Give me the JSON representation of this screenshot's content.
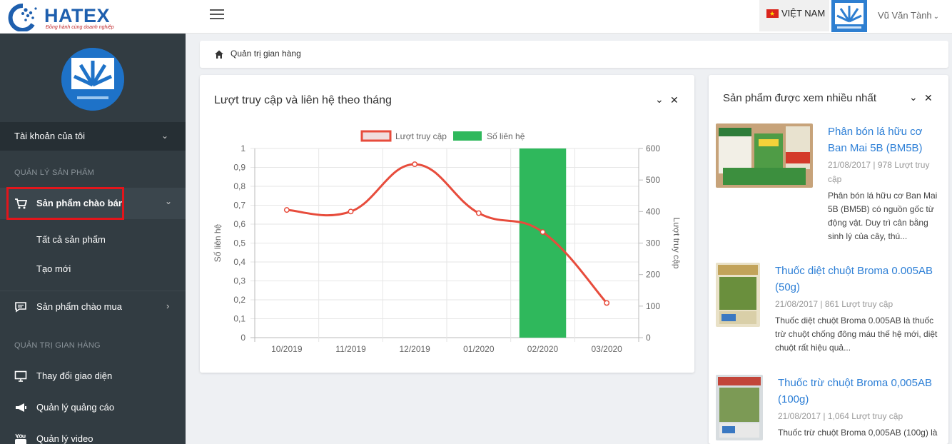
{
  "header": {
    "logo_name": "HATEX",
    "logo_tagline": "Đồng hành cùng doanh nghiệp",
    "language": "VIỆT NAM",
    "user_name": "Vũ Văn Tành"
  },
  "sidebar": {
    "account": "Tài khoản của tôi",
    "section_products": "QUẢN LÝ SẢN PHẨM",
    "offer_products": "Sản phẩm chào bán",
    "all_products": "Tất cả sản phẩm",
    "create_new": "Tạo mới",
    "buy_products": "Sản phẩm chào mua",
    "section_store": "QUẢN TRỊ GIAN HÀNG",
    "change_ui": "Thay đổi giao diện",
    "manage_ads": "Quản lý quảng cáo",
    "manage_video": "Quản lý video"
  },
  "breadcrumb": {
    "current": "Quản trị gian hàng"
  },
  "chart_card": {
    "title": "Lượt truy cập và liên hệ theo tháng"
  },
  "chart_data": {
    "type": "bar",
    "categories": [
      "10/2019",
      "11/2019",
      "12/2019",
      "01/2020",
      "02/2020",
      "03/2020"
    ],
    "series": [
      {
        "name": "Lượt truy cập",
        "type": "line",
        "axis": "right",
        "color": "#e74c3c",
        "values": [
          405,
          400,
          550,
          395,
          335,
          110
        ]
      },
      {
        "name": "Số liên hệ",
        "type": "bar",
        "axis": "left",
        "color": "#2fb85c",
        "values": [
          0,
          0,
          0,
          0,
          1,
          0
        ]
      }
    ],
    "ylabel": "Số liên hệ",
    "y2label": "Lượt truy cập",
    "ylim": [
      0,
      1
    ],
    "y2lim": [
      0,
      600
    ],
    "yticks": [
      "0",
      "0,1",
      "0,2",
      "0,3",
      "0,4",
      "0,5",
      "0,6",
      "0,7",
      "0,8",
      "0,9",
      "1"
    ],
    "y2ticks": [
      "0",
      "100",
      "200",
      "300",
      "400",
      "500",
      "600"
    ],
    "legend": "top",
    "grid": true
  },
  "popular": {
    "title": "Sản phẩm được xem nhiều nhất",
    "items": [
      {
        "title": "Phân bón lá hữu cơ Ban Mai 5B (BM5B)",
        "meta": "21/08/2017 | 978 Lượt truy cập",
        "desc": "Phân bón lá hữu cơ Ban Mai 5B (BM5B) có nguồn gốc từ động vật. Duy trì cân bằng sinh lý của cây, thú..."
      },
      {
        "title": "Thuốc diệt chuột Broma 0.005AB (50g)",
        "meta": "21/08/2017 | 861 Lượt truy cập",
        "desc": "Thuốc diệt chuột Broma 0.005AB là thuốc trừ chuột chống đông máu thế hệ mới, diệt chuột rất hiệu quả..."
      },
      {
        "title": "Thuốc trừ chuột Broma 0,005AB (100g)",
        "meta": "21/08/2017 | 1,064 Lượt truy cập",
        "desc": "Thuốc trừ chuột Broma 0,005AB (100g) là"
      }
    ]
  }
}
